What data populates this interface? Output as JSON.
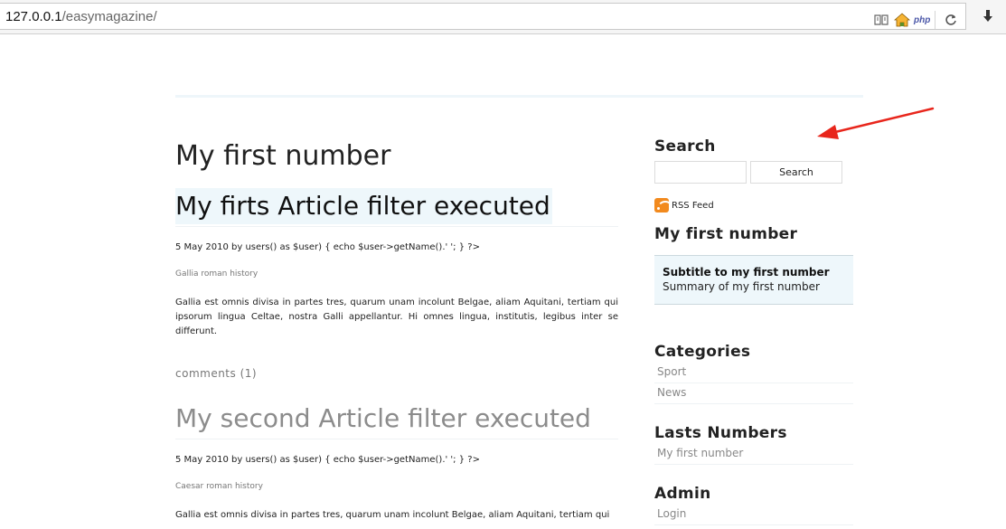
{
  "browser": {
    "url_host": "127.0.0.1",
    "url_path": "/easymagazine/",
    "php_label": "php"
  },
  "issue_title": "My first number",
  "articles": [
    {
      "title": "My firts Article filter executed",
      "meta": "5 May 2010 by users() as $user) { echo $user->getName().' '; } ?>",
      "category": "Gallia roman history",
      "body": "Gallia est omnis divisa in partes tres, quarum unam incolunt Belgae, aliam Aquitani, tertiam qui ipsorum lingua Celtae, nostra Galli appellantur. Hi omnes lingua, institutis, legibus inter se differunt.",
      "comments": "comments (1)"
    },
    {
      "title": "My second Article filter executed",
      "meta": "5 May 2010 by users() as $user) { echo $user->getName().' '; } ?>",
      "category": "Caesar roman history",
      "body": "Gallia est omnis divisa in partes tres, quarum unam incolunt Belgae, aliam Aquitani, tertiam qui"
    }
  ],
  "sidebar": {
    "search_heading": "Search",
    "search_button": "Search",
    "rss_label": "RSS Feed",
    "issue_heading": "My first number",
    "issue_subtitle": "Subtitle to my first number",
    "issue_summary": "Summary of my first number",
    "categories_heading": "Categories",
    "categories": [
      "Sport",
      "News"
    ],
    "numbers_heading": "Lasts Numbers",
    "numbers": [
      "My first number"
    ],
    "admin_heading": "Admin",
    "admin_links": [
      "Login"
    ]
  },
  "colors": {
    "accent_box": "#eef7fb",
    "arrow": "#e8261c",
    "rss": "#f28a1e"
  }
}
